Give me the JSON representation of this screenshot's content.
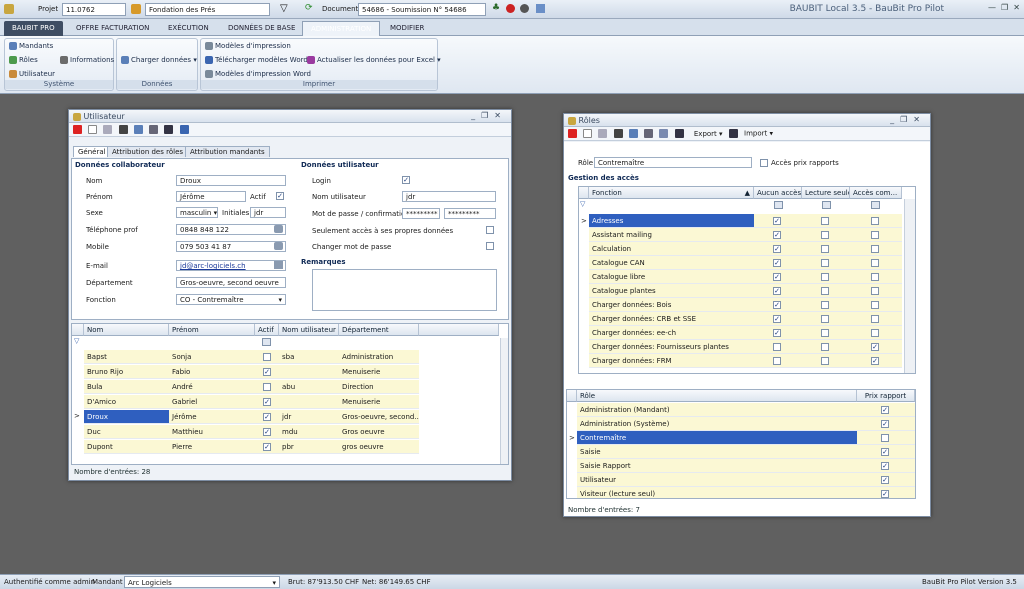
{
  "topbar": {
    "project_label": "Projet",
    "project_value": "11.0762",
    "foundation_value": "Fondation des Prés",
    "document_label": "Document",
    "document_value": "54686 - Soumission N° 54686",
    "app_title": "BAUBIT Local 3.5 - BauBit Pro Pilot"
  },
  "ribbon_tabs": [
    "BAUBIT PRO",
    "OFFRE FACTURATION",
    "EXÉCUTION",
    "DONNÉES DE BASE",
    "ADMINISTRATION",
    "MODIFIER"
  ],
  "ribbon": {
    "systeme": {
      "label": "Système",
      "items": [
        "Mandants",
        "Rôles",
        "Informations",
        "Utilisateur"
      ]
    },
    "donnees": {
      "label": "Données",
      "items": [
        "Charger données"
      ]
    },
    "imprimer": {
      "label": "Imprimer",
      "items": [
        "Modèles d'impression",
        "Télécharger modèles Word",
        "Actualiser les données pour Excel",
        "Modèles d'impression Word"
      ]
    }
  },
  "utilisateur": {
    "title": "Utilisateur",
    "tabs": [
      "Général",
      "Attribution des rôles",
      "Attribution mandants"
    ],
    "collab_header": "Données collaborateur",
    "user_header": "Données utilisateur",
    "fields": {
      "nom_label": "Nom",
      "nom": "Droux",
      "prenom_label": "Prénom",
      "prenom": "Jérôme",
      "actif_label": "Actif",
      "sexe_label": "Sexe",
      "sexe": "masculin",
      "initiales_label": "Initiales",
      "initiales": "jdr",
      "tel_label": "Téléphone prof",
      "tel": "0848 848 122",
      "mobile_label": "Mobile",
      "mobile": "079 503 41 87",
      "email_label": "E-mail",
      "email": "jd@arc-logiciels.ch",
      "dept_label": "Département",
      "dept": "Gros-oeuvre, second oeuvre",
      "fonction_label": "Fonction",
      "fonction": "CO - Contremaître",
      "login_label": "Login",
      "nomutil_label": "Nom utilisateur",
      "nomutil": "jdr",
      "mdp_label": "Mot de passe / confirmation",
      "mdp1": "*********",
      "mdp2": "*********",
      "seul_label": "Seulement accès à ses propres données",
      "chg_label": "Changer mot de passe",
      "remarques_label": "Remarques"
    },
    "grid": {
      "headers": [
        "Nom",
        "Prénom",
        "Actif",
        "Nom utilisateur",
        "Département"
      ],
      "rows": [
        {
          "nom": "Bapst",
          "prenom": "Sonja",
          "actif": false,
          "user": "sba",
          "dept": "Administration"
        },
        {
          "nom": "Bruno Rijo",
          "prenom": "Fabio",
          "actif": true,
          "user": "",
          "dept": "Menuiserie"
        },
        {
          "nom": "Bula",
          "prenom": "André",
          "actif": false,
          "user": "abu",
          "dept": "Direction"
        },
        {
          "nom": "D'Amico",
          "prenom": "Gabriel",
          "actif": true,
          "user": "",
          "dept": "Menuiserie"
        },
        {
          "nom": "Droux",
          "prenom": "Jérôme",
          "actif": true,
          "user": "jdr",
          "dept": "Gros-oeuvre, second..."
        },
        {
          "nom": "Duc",
          "prenom": "Matthieu",
          "actif": true,
          "user": "mdu",
          "dept": "Gros oeuvre"
        },
        {
          "nom": "Dupont",
          "prenom": "Pierre",
          "actif": true,
          "user": "pbr",
          "dept": "gros oeuvre"
        }
      ],
      "footer": "Nombre d'entrées: 28"
    }
  },
  "roles": {
    "title": "Rôles",
    "export_label": "Export",
    "import_label": "Import",
    "role_label": "Rôle",
    "role_value": "Contremaître",
    "acces_prix_label": "Accès prix rapports",
    "gestion_label": "Gestion des accès",
    "access_headers": [
      "Fonction",
      "Aucun accès",
      "Lecture seule",
      "Accès com..."
    ],
    "access_rows": [
      {
        "f": "Adresses",
        "a": [
          true,
          false,
          false
        ]
      },
      {
        "f": "Assistant mailing",
        "a": [
          true,
          false,
          false
        ]
      },
      {
        "f": "Calculation",
        "a": [
          true,
          false,
          false
        ]
      },
      {
        "f": "Catalogue CAN",
        "a": [
          true,
          false,
          false
        ]
      },
      {
        "f": "Catalogue libre",
        "a": [
          true,
          false,
          false
        ]
      },
      {
        "f": "Catalogue plantes",
        "a": [
          true,
          false,
          false
        ]
      },
      {
        "f": "Charger données: Bois",
        "a": [
          true,
          false,
          false
        ]
      },
      {
        "f": "Charger données: CRB et SSE",
        "a": [
          true,
          false,
          false
        ]
      },
      {
        "f": "Charger données: ee-ch",
        "a": [
          true,
          false,
          false
        ]
      },
      {
        "f": "Charger données: Fournisseurs plantes",
        "a": [
          false,
          false,
          true
        ]
      },
      {
        "f": "Charger données: FRM",
        "a": [
          false,
          false,
          true
        ]
      }
    ],
    "role_headers": [
      "Rôle",
      "Prix rapport"
    ],
    "role_rows": [
      {
        "r": "Administration (Mandant)",
        "p": true
      },
      {
        "r": "Administration (Système)",
        "p": true
      },
      {
        "r": "Contremaître",
        "p": false
      },
      {
        "r": "Saisie",
        "p": true
      },
      {
        "r": "Saisie Rapport",
        "p": true
      },
      {
        "r": "Utilisateur",
        "p": true
      },
      {
        "r": "Visiteur (lecture seul)",
        "p": true
      }
    ],
    "footer": "Nombre d'entrées: 7"
  },
  "status": {
    "auth": "Authentifié comme  admin",
    "mandant_label": "Mandant",
    "mandant": "Arc Logiciels",
    "brut": "Brut: 87'913.50 CHF",
    "net": "Net: 86'149.65 CHF",
    "version": "BauBit Pro Pilot Version 3.5"
  },
  "colors": {
    "accent": "#2f5fbf",
    "highlight": "#fbf8d4",
    "frame": "#606060"
  }
}
